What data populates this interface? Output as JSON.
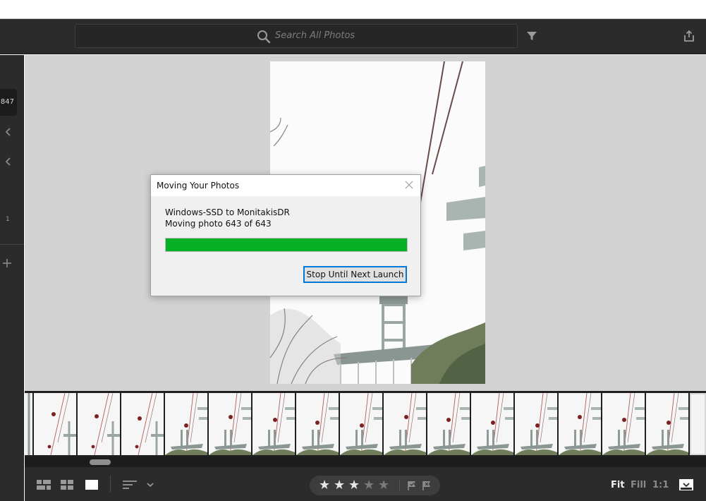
{
  "topbar": {
    "search_placeholder": "Search All Photos",
    "icons": {
      "search": "search-icon",
      "filter": "filter-icon",
      "share": "share-icon"
    }
  },
  "left_rail": {
    "count_badge": "847",
    "number": "1"
  },
  "dialog": {
    "title": "Moving Your Photos",
    "line1": "Windows-SSD to MonitakisDR",
    "line2": "Moving photo 643 of 643",
    "progress_fraction": 1.0,
    "stop_button": "Stop Until Next Launch"
  },
  "bottombar": {
    "rating": {
      "filled_stars": 3,
      "total_stars": 5
    },
    "zoom_options": [
      "Fit",
      "Fill",
      "1:1"
    ],
    "active_zoom": "Fit"
  },
  "colors": {
    "app_bg": "#2b2b2b",
    "viewer_bg": "#d3d3d3",
    "progress_green": "#06b025",
    "dialog_button_focus": "#0078d7"
  }
}
